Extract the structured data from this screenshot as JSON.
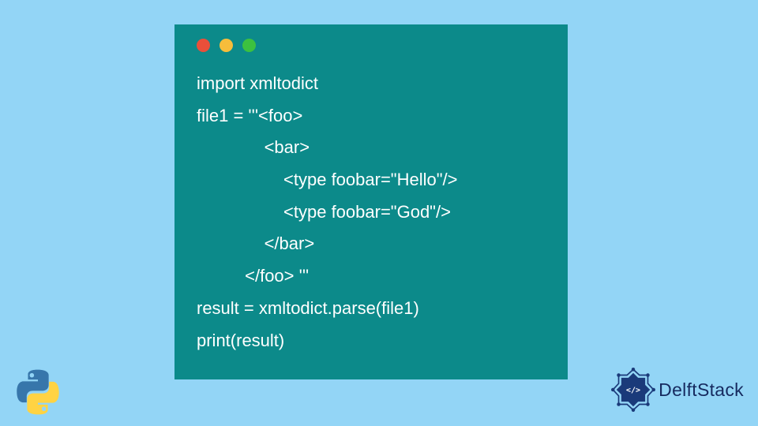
{
  "code": {
    "line1": "import xmltodict",
    "line2": "file1 = '''<foo>",
    "line3": "              <bar>",
    "line4": "                  <type foobar=\"Hello\"/>",
    "line5": "                  <type foobar=\"God\"/>",
    "line6": "              </bar>",
    "line7": "          </foo> '''",
    "line8": "result = xmltodict.parse(file1)",
    "line9": "print(result)"
  },
  "brand": {
    "name": "DelftStack"
  }
}
